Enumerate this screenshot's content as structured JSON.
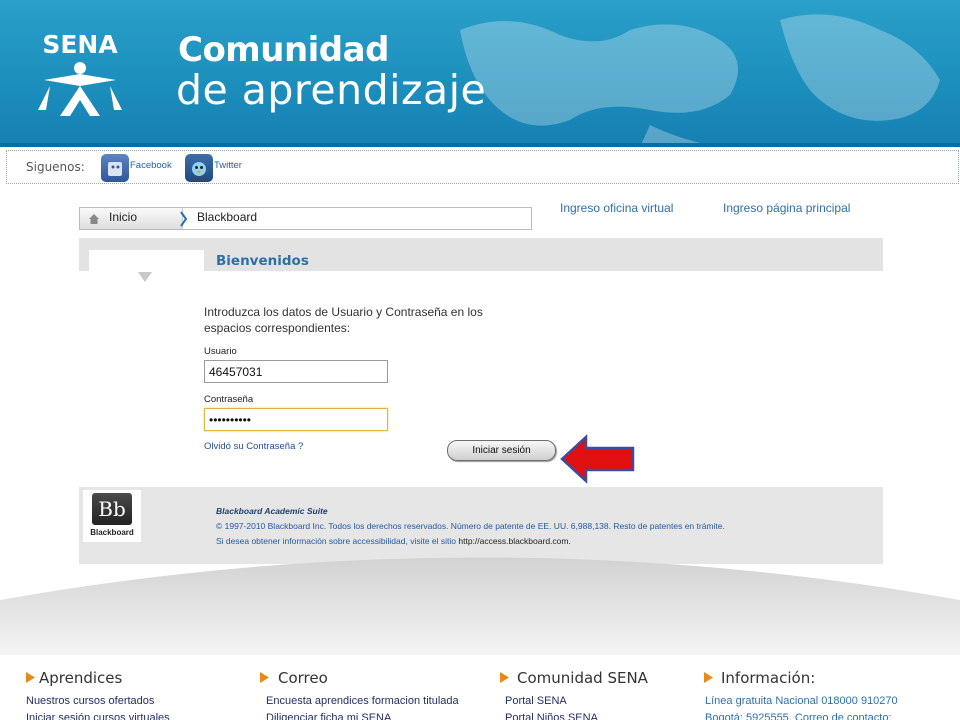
{
  "header": {
    "logo_text": "SENA",
    "title_line1": "Comunidad",
    "title_line2": "de aprendizaje"
  },
  "social": {
    "label": "Siguenos:",
    "facebook": "Facebook",
    "twitter": "Twitter"
  },
  "breadcrumb": {
    "home": "Inicio",
    "current": "Blackboard"
  },
  "top_links": {
    "virtual_office": "Ingreso oficina virtual",
    "main_page": "Ingreso página principal"
  },
  "login": {
    "section_title": "Bienvenidos",
    "intro": "Introduzca los datos de Usuario y Contraseña en los espacios correspondientes:",
    "username_label": "Usuario",
    "username_value": "46457031",
    "password_label": "Contraseña",
    "password_value": "••••••••••",
    "forgot_link": "Olvidó su Contraseña ?",
    "submit_label": "Iniciar sesión"
  },
  "blackboard": {
    "logo_mark": "Bb",
    "logo_word": "Blackboard",
    "product": "Blackboard Academic Suite",
    "copyright": "© 1997-2010 Blackboard Inc. Todos los derechos reservados. Número de patente de EE. UU. 6,988,138. Resto de patentes en trámite.",
    "accessibility_text": "Si desea obtener información sobre accessibilidad, visite el sitio",
    "accessibility_url": "http://access.blackboard.com."
  },
  "footer": {
    "columns": [
      {
        "heading": "Aprendices",
        "items": [
          "Nuestros cursos ofertados",
          "Iniciar sesión cursos virtuales"
        ]
      },
      {
        "heading": "Correo",
        "items": [
          "Encuesta aprendices formacion titulada",
          "Diligenciar ficha mi SENA"
        ]
      },
      {
        "heading": "Comunidad SENA",
        "items": [
          "Portal SENA",
          "Portal Niños SENA"
        ]
      },
      {
        "heading": "Información:",
        "items": [
          "Línea gratuita Nacional 018000 910270",
          "Bogotá: 5925555. Correo de contacto:"
        ]
      }
    ]
  },
  "colors": {
    "banner": "#1d8fbd",
    "link": "#2e6fb3",
    "footer_bullet": "#e88a1a",
    "arrow": "#e01010"
  }
}
